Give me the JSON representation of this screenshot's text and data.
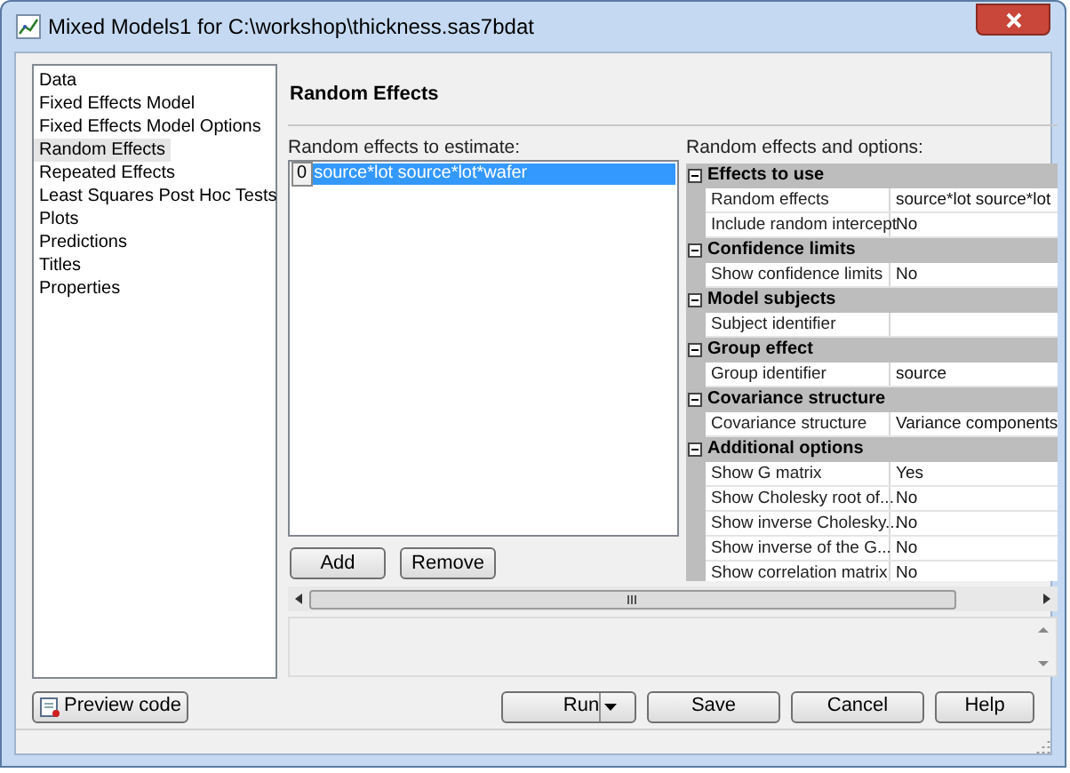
{
  "window": {
    "title": "Mixed Models1 for C:\\workshop\\thickness.sas7bdat"
  },
  "nav": {
    "items": [
      {
        "label": "Data",
        "selected": false
      },
      {
        "label": "Fixed Effects Model",
        "selected": false
      },
      {
        "label": "Fixed Effects Model Options",
        "selected": false
      },
      {
        "label": "Random Effects",
        "selected": true
      },
      {
        "label": "Repeated Effects",
        "selected": false
      },
      {
        "label": "Least Squares Post Hoc Tests",
        "selected": false
      },
      {
        "label": "Plots",
        "selected": false
      },
      {
        "label": "Predictions",
        "selected": false
      },
      {
        "label": "Titles",
        "selected": false
      },
      {
        "label": "Properties",
        "selected": false
      }
    ]
  },
  "header": "Random Effects",
  "effects_list": {
    "label": "Random effects to estimate:",
    "items": [
      {
        "index": "0",
        "text": "source*lot source*lot*wafer",
        "selected": true
      }
    ]
  },
  "list_buttons": [
    "Add",
    "Remove"
  ],
  "options": {
    "label": "Random effects and options:",
    "categories": [
      {
        "title": "Effects to use",
        "expanded": true,
        "rows": [
          {
            "name": "Random effects",
            "value": "source*lot  source*lot"
          },
          {
            "name": "Include random intercept",
            "value": "No"
          }
        ]
      },
      {
        "title": "Confidence limits",
        "expanded": true,
        "rows": [
          {
            "name": "Show confidence limits",
            "value": "No"
          }
        ]
      },
      {
        "title": "Model subjects",
        "expanded": true,
        "rows": [
          {
            "name": "Subject identifier"
          }
        ]
      },
      {
        "title": "Group effect",
        "expanded": true,
        "rows": [
          {
            "name": "Group identifier",
            "value": "source"
          }
        ]
      },
      {
        "title": "Covariance structure",
        "expanded": true,
        "rows": [
          {
            "name": "Covariance structure",
            "value": "Variance components"
          }
        ]
      },
      {
        "title": "Additional options",
        "expanded": true,
        "rows": [
          {
            "name": "Show G matrix",
            "value": "Yes"
          },
          {
            "name": "Show Cholesky root of...",
            "value": "No"
          },
          {
            "name": "Show inverse Cholesky...",
            "value": "No"
          },
          {
            "name": "Show inverse of the G...",
            "value": "No"
          },
          {
            "name": "Show correlation matrix",
            "value": "No"
          }
        ]
      }
    ]
  },
  "footer_buttons": [
    {
      "label": "Preview code",
      "kind": "preview"
    },
    {
      "label": "Run",
      "kind": "split"
    },
    {
      "label": "Save",
      "kind": "plain"
    },
    {
      "label": "Cancel",
      "kind": "plain"
    },
    {
      "label": "Help",
      "kind": "plain"
    }
  ]
}
